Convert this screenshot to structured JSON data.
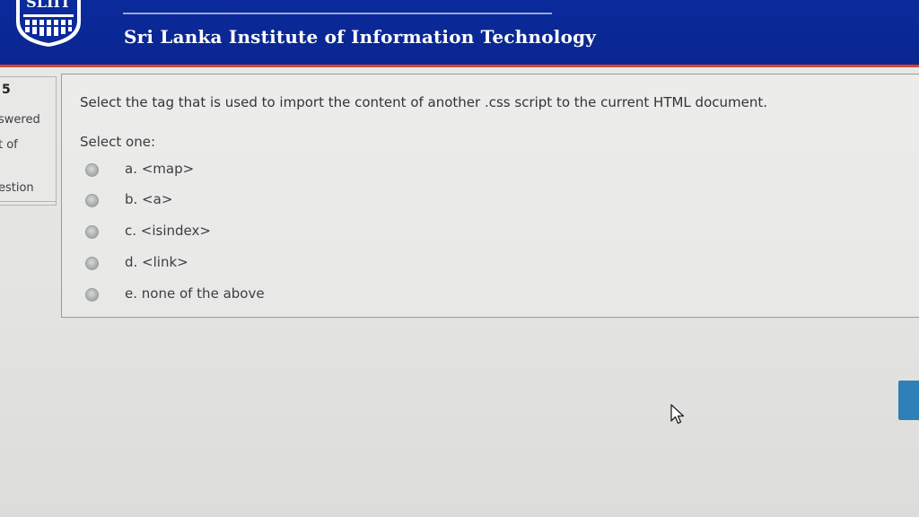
{
  "header": {
    "logo_text": "SLIIT",
    "title": "Sri Lanka Institute of Information Technology"
  },
  "info_panel": {
    "number": "5",
    "line1": "swered",
    "line2": "t of",
    "line3": "estion"
  },
  "question": {
    "text": "Select the tag that is used to import the content of another .css script to the current HTML document.",
    "prompt": "Select one:",
    "options": [
      {
        "label": "a. <map>",
        "selected": false
      },
      {
        "label": "b. <a>",
        "selected": false
      },
      {
        "label": "c. <isindex>",
        "selected": false
      },
      {
        "label": "d. <link>",
        "selected": false
      },
      {
        "label": "e. none of the above",
        "selected": false
      }
    ]
  },
  "colors": {
    "header_blue": "#0b2a9b",
    "header_accent": "#d8452f",
    "button_blue": "#2f7fb8"
  }
}
